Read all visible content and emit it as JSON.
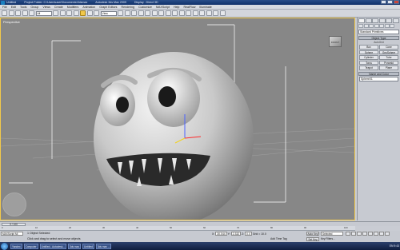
{
  "window": {
    "title_segments": [
      "Untitled",
      "Project Folder: C:\\Users\\user\\Documents\\3dsmax",
      "Autodesk 3ds Max 2009",
      "Display : Direct 3D"
    ]
  },
  "menu": [
    "File",
    "Edit",
    "Tools",
    "Group",
    "Views",
    "Create",
    "Modifiers",
    "Animation",
    "Graph Editors",
    "Rendering",
    "Customize",
    "MAXScript",
    "Help",
    "RealFlow",
    "Illuminate"
  ],
  "toolbar": {
    "selection_filter": "All",
    "view_dropdown": "View"
  },
  "viewport": {
    "label": "Perspective",
    "viewcube_label": "FRONT"
  },
  "command_panel": {
    "category_dropdown": "Standard Primitives",
    "rollout_object_type": "Object Type",
    "autogrid": "AutoGrid",
    "buttons": [
      "Box",
      "Cone",
      "Sphere",
      "GeoSphere",
      "Cylinder",
      "Tube",
      "Torus",
      "Pyramid",
      "Teapot",
      "Plane"
    ],
    "rollout_name_color": "Name and Color",
    "object_name": "Sphere01"
  },
  "timeline": {
    "position": "0 / 100",
    "ticks": [
      "0",
      "10",
      "20",
      "30",
      "40",
      "50",
      "60",
      "70",
      "80",
      "90",
      "100"
    ]
  },
  "status": {
    "script_listener": "MAXScript Mi",
    "selection_msg": "1 Object Selected",
    "prompt": "Click and drag to select and move objects",
    "x_label": "X:",
    "x_value": "30.044",
    "y_label": "Y:",
    "y_value": "2.332",
    "z_label": "Z:",
    "z_value": "0.0",
    "grid": "Grid = 10.0",
    "add_time_tag": "Add Time Tag",
    "auto_key": "Auto Key",
    "set_key": "Set Key",
    "selected_dd": "Selected",
    "key_filters": "Key Filters..."
  },
  "taskbar": {
    "items": [
      "Yandex",
      "Computer",
      "Untitled - Autodesk...",
      "3ds max",
      "Untitled",
      "3ds max ..."
    ],
    "clock": "EN 9:43"
  }
}
